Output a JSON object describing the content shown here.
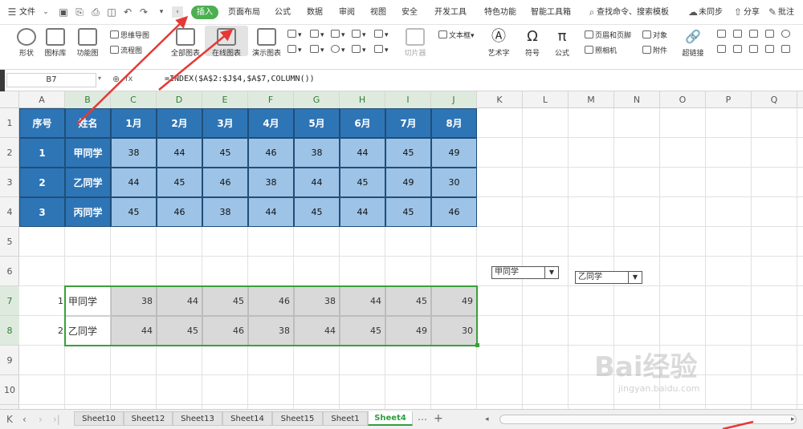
{
  "menubar": {
    "file": "文件",
    "tabs": [
      "插入",
      "页面布局",
      "公式",
      "数据",
      "审阅",
      "视图",
      "安全",
      "开发工具",
      "特色功能",
      "智能工具箱"
    ],
    "search": "查找命令、搜索模板",
    "sync": "未同步",
    "share": "分享",
    "comment": "批注"
  },
  "ribbon": {
    "shape": "形状",
    "iconlib": "图标库",
    "funcchart": "功能图",
    "mindmap": "思维导图",
    "flowchart": "流程图",
    "allcharts": "全部图表",
    "onlinecharts": "在线图表",
    "democharts": "演示图表",
    "slicer": "切片器",
    "textbox": "文本框",
    "wordart": "艺术字",
    "symbol": "符号",
    "formula": "公式",
    "headerfooter": "页眉和页脚",
    "object": "对象",
    "camera": "照相机",
    "attachment": "附件",
    "hyperlink": "超链接"
  },
  "formulabar": {
    "namebox": "B7",
    "fx": "fx",
    "formula": "=INDEX($A$2:$J$4,$A$7,COLUMN())"
  },
  "columns": [
    "A",
    "B",
    "C",
    "D",
    "E",
    "F",
    "G",
    "H",
    "I",
    "J",
    "K",
    "L",
    "M",
    "N",
    "O",
    "P",
    "Q"
  ],
  "rows": [
    "1",
    "2",
    "3",
    "4",
    "5",
    "6",
    "7",
    "8",
    "9",
    "10"
  ],
  "table": {
    "headers": [
      "序号",
      "姓名",
      "1月",
      "2月",
      "3月",
      "4月",
      "5月",
      "6月",
      "7月",
      "8月"
    ],
    "rows": [
      [
        "1",
        "甲同学",
        "38",
        "44",
        "45",
        "46",
        "38",
        "44",
        "45",
        "49"
      ],
      [
        "2",
        "乙同学",
        "44",
        "45",
        "46",
        "38",
        "44",
        "45",
        "49",
        "30"
      ],
      [
        "3",
        "丙同学",
        "45",
        "46",
        "38",
        "44",
        "45",
        "44",
        "45",
        "46"
      ]
    ]
  },
  "lookup": {
    "rows": [
      [
        "1",
        "甲同学",
        "38",
        "44",
        "45",
        "46",
        "38",
        "44",
        "45",
        "49"
      ],
      [
        "2",
        "乙同学",
        "44",
        "45",
        "46",
        "38",
        "44",
        "45",
        "49",
        "30"
      ]
    ]
  },
  "combos": {
    "combo1": "甲同学",
    "combo2": "乙同学"
  },
  "sheets": [
    "Sheet10",
    "Sheet12",
    "Sheet13",
    "Sheet14",
    "Sheet15",
    "Sheet1",
    "Sheet4"
  ],
  "active_sheet": "Sheet4",
  "watermark": "Bai经验",
  "watermark_sub": "jingyan.baidu.com",
  "colors": {
    "header_blue": "#2e75b6",
    "value_blue": "#9dc3e6",
    "accent_green": "#4caf50",
    "arrow_red": "#e53935"
  }
}
